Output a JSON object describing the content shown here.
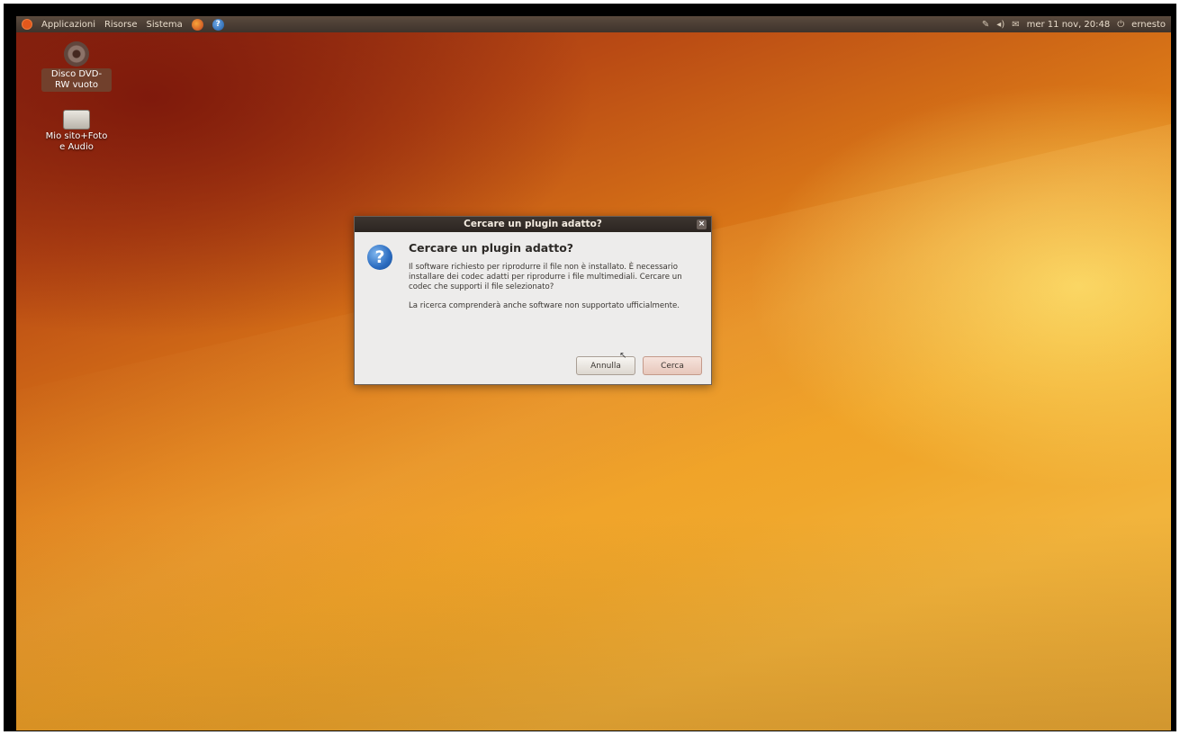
{
  "top_panel": {
    "menus": [
      "Applicazioni",
      "Risorse",
      "Sistema"
    ],
    "clock": "mer 11 nov, 20:48",
    "user": "ernesto"
  },
  "desktop_icons": [
    {
      "label": "Disco DVD-RW vuoto",
      "icon": "dvd-disc-icon",
      "selected": true
    },
    {
      "label": "Mio sito+Foto e Audio",
      "icon": "drive-icon",
      "selected": false
    }
  ],
  "dialog": {
    "window_title": "Cercare un plugin adatto?",
    "heading": "Cercare un plugin adatto?",
    "message": "Il software richiesto per riprodurre il file non è installato. È necessario installare dei codec adatti per riprodurre i file multimediali. Cercare un codec che supporti il file selezionato?",
    "note": "La ricerca comprenderà anche software non supportato ufficialmente.",
    "icon": "question-icon",
    "buttons": {
      "cancel": "Annulla",
      "search": "Cerca"
    }
  },
  "colors": {
    "panel": "#3e332c",
    "dialog_bg": "#edeceb",
    "wallpaper_accent": "#de7d18"
  }
}
